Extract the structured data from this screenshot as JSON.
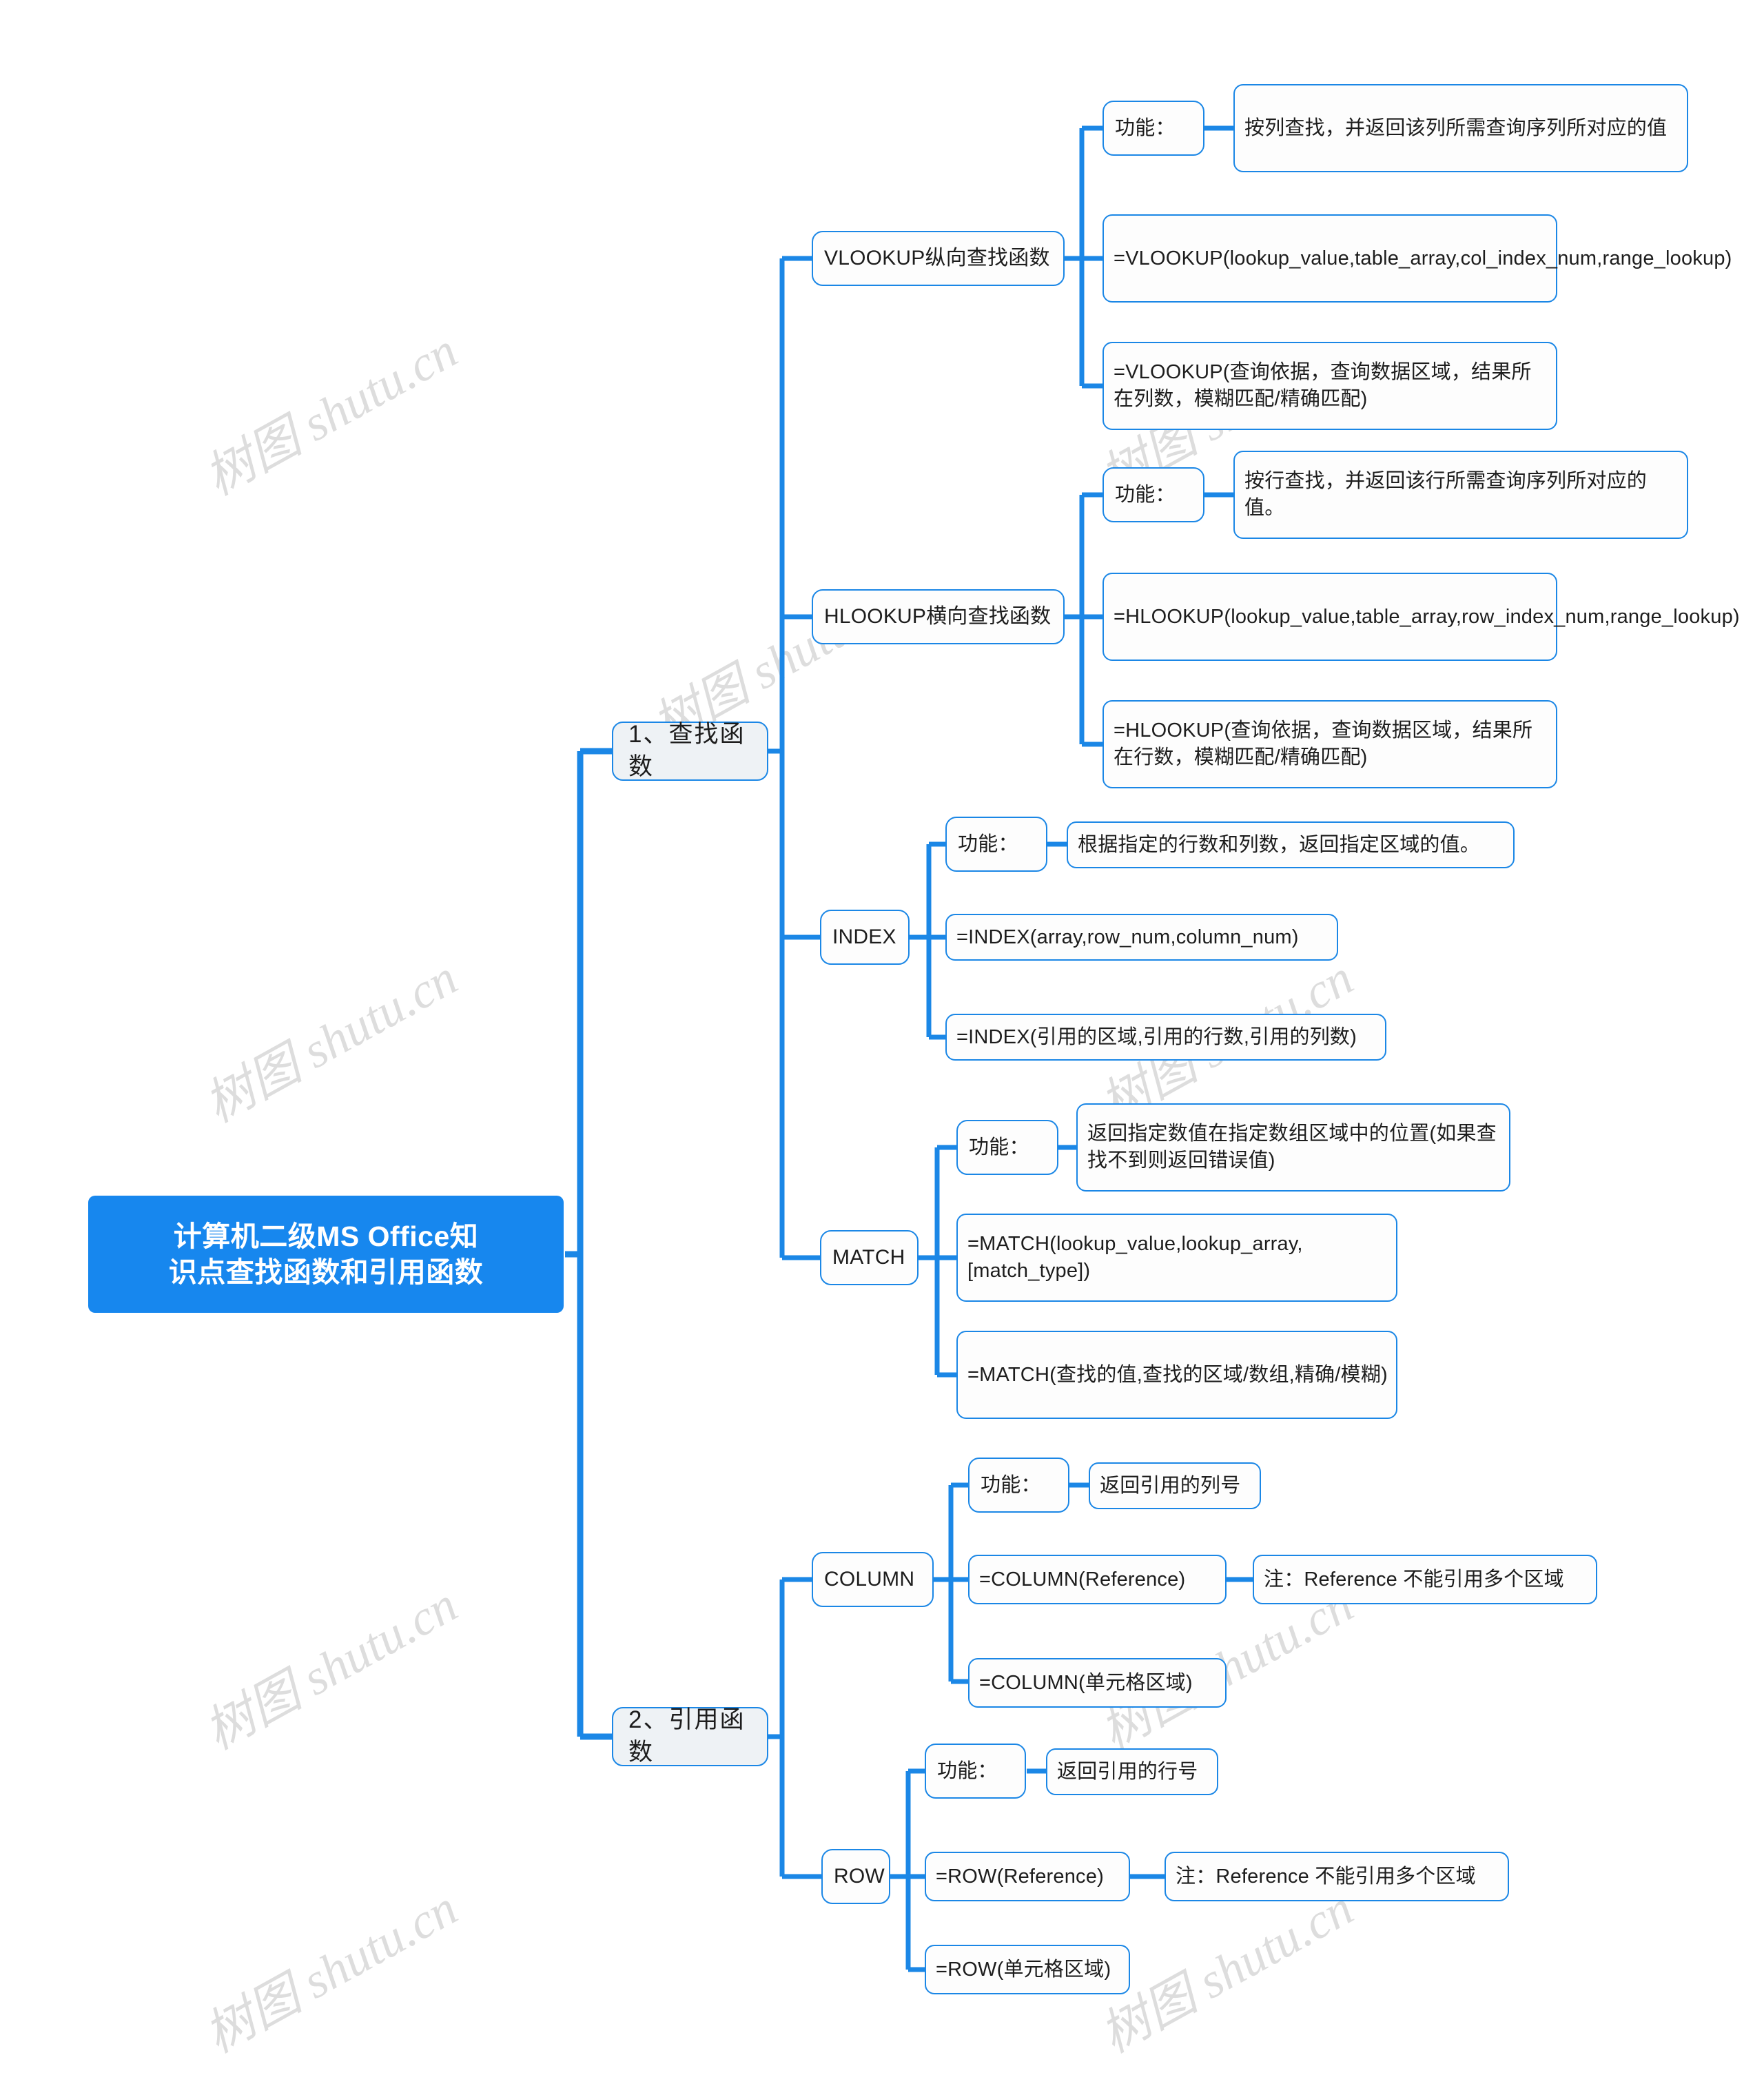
{
  "document": {
    "type": "mindmap",
    "title": "计算机二级MS Office知识点查找函数和引用函数",
    "watermark_text": "树图 shutu.cn",
    "colors": {
      "root_fill": "#1787ee",
      "root_text": "#ffffff",
      "node_border": "#1b87e6",
      "node_fill": "#fdfdfd",
      "level1_fill": "#eef2f5",
      "connector": "#1b87e6",
      "text": "#1d1d1d",
      "watermark": "#dcdcdc",
      "background": "#ffffff"
    }
  },
  "root": {
    "label": "计算机二级MS Office知识点查找函数和引用函数",
    "line1": "计算机二级MS Office知",
    "line2": "识点查找函数和引用函数"
  },
  "branches": [
    {
      "id": "lookup-functions",
      "label": "1、查找函数",
      "children": [
        {
          "id": "vlookup",
          "label": "VLOOKUP纵向查找函数",
          "children": [
            {
              "id": "vlookup-gongneng",
              "label": "功能：",
              "children": [
                {
                  "id": "vlookup-gongneng-desc",
                  "label": "按列查找，并返回该列所需查询序列所对应的值"
                }
              ]
            },
            {
              "id": "vlookup-syntax-en",
              "label": "=VLOOKUP(lookup_value,table_array,col_index_num,range_lookup)"
            },
            {
              "id": "vlookup-syntax-cn",
              "label": "=VLOOKUP(查询依据，查询数据区域，结果所在列数，模糊匹配/精确匹配)"
            }
          ]
        },
        {
          "id": "hlookup",
          "label": "HLOOKUP横向查找函数",
          "children": [
            {
              "id": "hlookup-gongneng",
              "label": "功能：",
              "children": [
                {
                  "id": "hlookup-gongneng-desc",
                  "label": "按行查找，并返回该行所需查询序列所对应的值。"
                }
              ]
            },
            {
              "id": "hlookup-syntax-en",
              "label": "=HLOOKUP(lookup_value,table_array,row_index_num,range_lookup)"
            },
            {
              "id": "hlookup-syntax-cn",
              "label": "=HLOOKUP(查询依据，查询数据区域，结果所在行数，模糊匹配/精确匹配)"
            }
          ]
        },
        {
          "id": "index",
          "label": "INDEX",
          "children": [
            {
              "id": "index-gongneng",
              "label": "功能：",
              "children": [
                {
                  "id": "index-gongneng-desc",
                  "label": "根据指定的行数和列数，返回指定区域的值。"
                }
              ]
            },
            {
              "id": "index-syntax-en",
              "label": "=INDEX(array,row_num,column_num)"
            },
            {
              "id": "index-syntax-cn",
              "label": "=INDEX(引用的区域,引用的行数,引用的列数)"
            }
          ]
        },
        {
          "id": "match",
          "label": "MATCH",
          "children": [
            {
              "id": "match-gongneng",
              "label": "功能：",
              "children": [
                {
                  "id": "match-gongneng-desc",
                  "label": "返回指定数值在指定数组区域中的位置(如果查找不到则返回错误值)"
                }
              ]
            },
            {
              "id": "match-syntax-en",
              "label": "=MATCH(lookup_value,lookup_array,[match_type])"
            },
            {
              "id": "match-syntax-cn",
              "label": "=MATCH(查找的值,查找的区域/数组,精确/模糊)"
            }
          ]
        }
      ]
    },
    {
      "id": "reference-functions",
      "label": "2、引用函数",
      "children": [
        {
          "id": "column",
          "label": "COLUMN",
          "children": [
            {
              "id": "column-gongneng",
              "label": "功能：",
              "children": [
                {
                  "id": "column-gongneng-desc",
                  "label": "返回引用的列号"
                }
              ]
            },
            {
              "id": "column-syntax-en",
              "label": "=COLUMN(Reference)",
              "children": [
                {
                  "id": "column-note",
                  "label": "注：Reference 不能引用多个区域"
                }
              ]
            },
            {
              "id": "column-syntax-cn",
              "label": "=COLUMN(单元格区域)"
            }
          ]
        },
        {
          "id": "row",
          "label": "ROW",
          "children": [
            {
              "id": "row-gongneng",
              "label": "功能：",
              "children": [
                {
                  "id": "row-gongneng-desc",
                  "label": "返回引用的行号"
                }
              ]
            },
            {
              "id": "row-syntax-en",
              "label": "=ROW(Reference)",
              "children": [
                {
                  "id": "row-note",
                  "label": "注：Reference 不能引用多个区域"
                }
              ]
            },
            {
              "id": "row-syntax-cn",
              "label": "=ROW(单元格区域)"
            }
          ]
        }
      ]
    }
  ],
  "node_text": {
    "root": "计算机二级MS Office知识点查找函数和引用函数",
    "b1": "1、查找函数",
    "b2": "2、引用函数",
    "vlookup": "VLOOKUP纵向查找函数",
    "vlookup_fn": "功能：",
    "vlookup_fn_desc": "按列查找，并返回该列所需查询序列所对应的值",
    "vlookup_en": "=VLOOKUP(lookup_value,table_array,col_index_num,range_lookup)",
    "vlookup_cn": "=VLOOKUP(查询依据，查询数据区域，结果所在列数，模糊匹配/精确匹配)",
    "hlookup": "HLOOKUP横向查找函数",
    "hlookup_fn": "功能：",
    "hlookup_fn_desc": "按行查找，并返回该行所需查询序列所对应的值。",
    "hlookup_en": "=HLOOKUP(lookup_value,table_array,row_index_num,range_lookup)",
    "hlookup_cn": "=HLOOKUP(查询依据，查询数据区域，结果所在行数，模糊匹配/精确匹配)",
    "index": "INDEX",
    "index_fn": "功能：",
    "index_fn_desc": "根据指定的行数和列数，返回指定区域的值。",
    "index_en": "=INDEX(array,row_num,column_num)",
    "index_cn": "=INDEX(引用的区域,引用的行数,引用的列数)",
    "match": "MATCH",
    "match_fn": "功能：",
    "match_fn_desc": "返回指定数值在指定数组区域中的位置(如果查找不到则返回错误值)",
    "match_en": "=MATCH(lookup_value,lookup_array,[match_type])",
    "match_cn": "=MATCH(查找的值,查找的区域/数组,精确/模糊)",
    "column": "COLUMN",
    "column_fn": "功能：",
    "column_fn_desc": "返回引用的列号",
    "column_en": "=COLUMN(Reference)",
    "column_note": "注：Reference 不能引用多个区域",
    "column_cn": "=COLUMN(单元格区域)",
    "row": "ROW",
    "row_fn": "功能：",
    "row_fn_desc": "返回引用的行号",
    "row_en": "=ROW(Reference)",
    "row_note": "注：Reference 不能引用多个区域",
    "row_cn": "=ROW(单元格区域)"
  },
  "watermarks": [
    {
      "text": "树图 shutu.cn"
    },
    {
      "text": "树图 shutu.cn"
    },
    {
      "text": "树图 shutu.cn"
    },
    {
      "text": "树图 shutu.cn"
    },
    {
      "text": "树图 shutu.cn"
    },
    {
      "text": "树图 shutu.cn"
    },
    {
      "text": "树图 shutu.cn"
    },
    {
      "text": "树图 shutu.cn"
    },
    {
      "text": "树图 shutu.cn"
    }
  ]
}
